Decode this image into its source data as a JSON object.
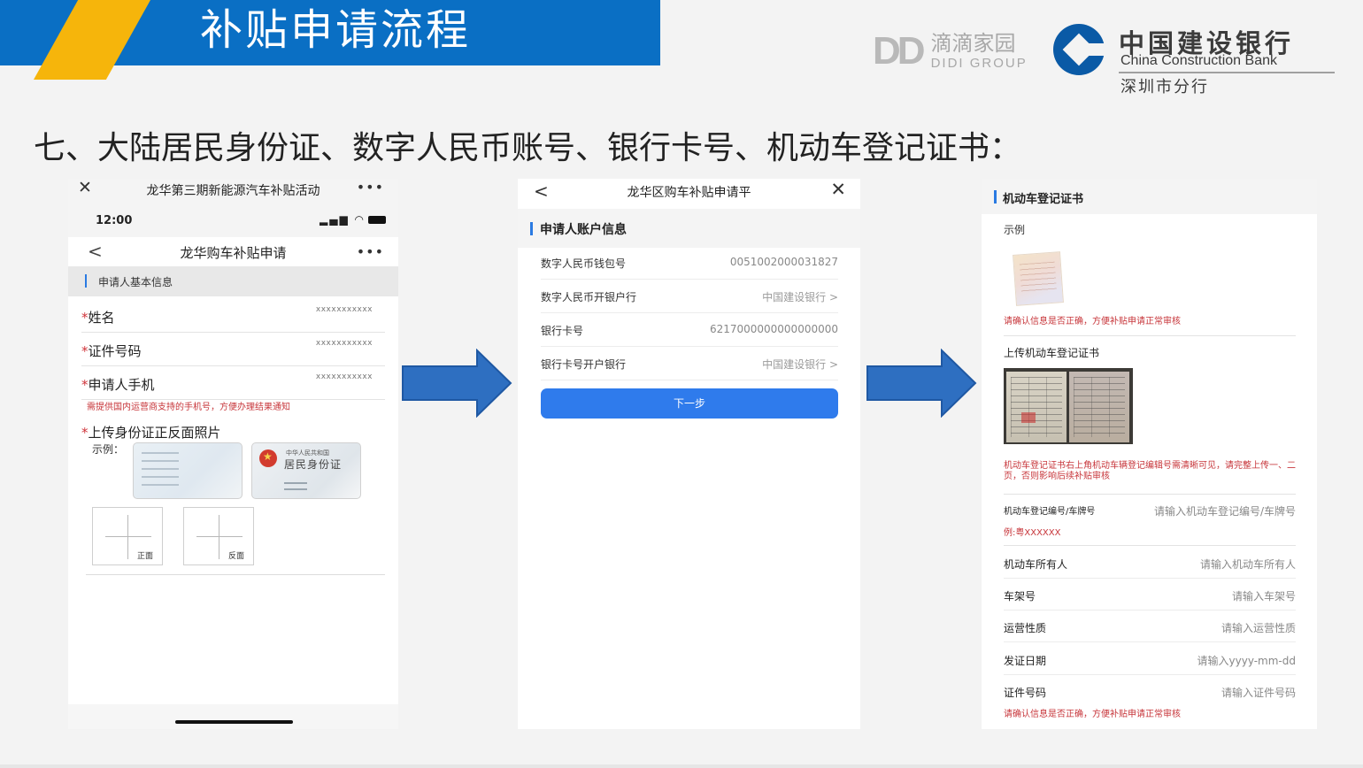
{
  "header": {
    "title": "补贴申请流程",
    "didi": {
      "mark": "DD",
      "cn": "滴滴家园",
      "en": "DIDI GROUP"
    },
    "ccb": {
      "cn": "中国建设银行",
      "en": "China Construction Bank",
      "branch": "深圳市分行"
    },
    "colors": {
      "bar": "#0a6fc4",
      "accent": "#f6b50b"
    }
  },
  "section_heading": "七、大陆居民身份证、数字人民币账号、银行卡号、机动车登记证书：",
  "panel1": {
    "close_icon": "close-icon",
    "top_title": "龙华第三期新能源汽车补贴活动",
    "more": "•••",
    "time": "12:00",
    "signal": "▂▄▆ ◠",
    "nav_back": "<",
    "nav_title": "龙华购车补贴申请",
    "section": "申请人基本信息",
    "required_mark": "*",
    "fields": [
      {
        "label": "姓名",
        "value": "xxxxxxxxxxx"
      },
      {
        "label": "证件号码",
        "value": "xxxxxxxxxxx"
      },
      {
        "label": "申请人手机",
        "value": "xxxxxxxxxxx"
      }
    ],
    "phone_hint": "需提供国内运营商支持的手机号，方便办理结果通知",
    "upload_label": "上传身份证正反面照片",
    "example_label": "示例：",
    "id_back": {
      "country": "中华人民共和国",
      "title": "居民身份证"
    },
    "upload_front": "正面",
    "upload_back": "反面"
  },
  "panel2": {
    "back": "<",
    "title": "龙华区购车补贴申请平",
    "close": "✕",
    "section": "申请人账户信息",
    "rows": [
      {
        "label": "数字人民币钱包号",
        "value": "0051002000031827"
      },
      {
        "label": "数字人民币开银户行",
        "value": "中国建设银行  >"
      },
      {
        "label": "银行卡号",
        "value": "6217000000000000000"
      },
      {
        "label": "银行卡号开户银行",
        "value": "中国建设银行  >"
      }
    ],
    "next_button": "下一步",
    "button_color": "#2f7bec"
  },
  "panel3": {
    "section": "机动车登记证书",
    "example": "示例",
    "hint_top": "请确认信息是否正确，方便补贴申请正常审核",
    "upload_title": "上传机动车登记证书",
    "hint_mid": "机动车登记证书右上角机动车辆登记编辑号需清晰可见，请完整上传一、二页，否则影响后续补贴审核",
    "plate_label": "机动车登记编号/车牌号",
    "plate_placeholder": "请输入机动车登记编号/车牌号",
    "plate_example": "例:粤XXXXXX",
    "rows": [
      {
        "label": "机动车所有人",
        "placeholder": "请输入机动车所有人"
      },
      {
        "label": "车架号",
        "placeholder": "请输入车架号"
      },
      {
        "label": "运营性质",
        "placeholder": "请输入运营性质"
      },
      {
        "label": "发证日期",
        "placeholder": "请输入yyyy-mm-dd"
      },
      {
        "label": "证件号码",
        "placeholder": "请输入证件号码"
      }
    ],
    "hint_bottom": "请确认信息是否正确，方便补贴申请正常审核"
  }
}
